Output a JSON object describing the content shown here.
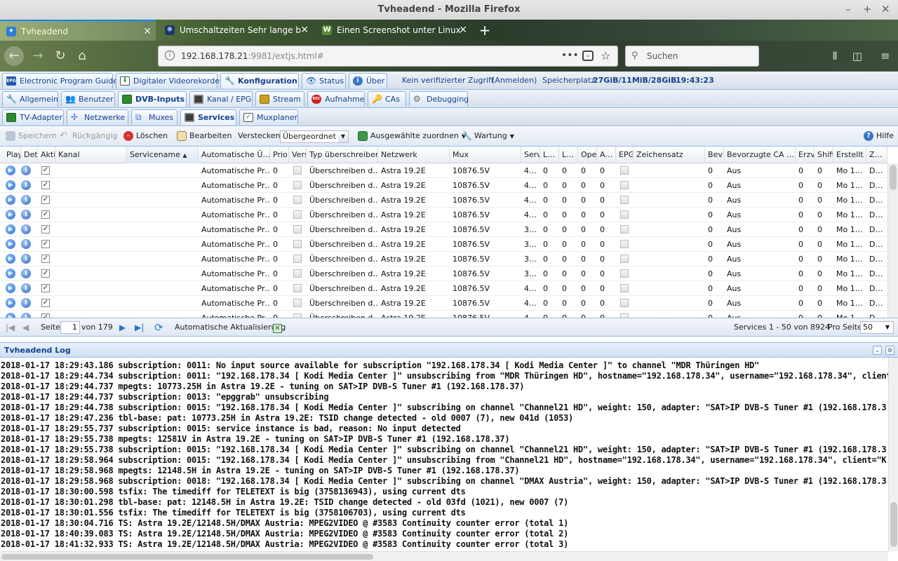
{
  "window": {
    "title": "Tvheadend - Mozilla Firefox"
  },
  "browser": {
    "tabs": [
      {
        "label": "Tvheadend",
        "active": true
      },
      {
        "label": "Umschaltzeiten Sehr lange b",
        "active": false
      },
      {
        "label": "Einen Screenshot unter Linux",
        "active": false
      }
    ],
    "url_host": "192.168.178.21",
    "url_rest": ":9981/extjs.html#",
    "search_placeholder": "Suchen"
  },
  "main_tabs": [
    "Electronic Program Guide",
    "Digitaler Videorekorder",
    "Konfiguration",
    "Status",
    "Über"
  ],
  "status_info": {
    "access": "Kein verifizierter Zugriff",
    "login": "(Anmelden)",
    "storage_label": "Speicherplatz:",
    "storage_value": "27GiB/11MiB/28GiB",
    "time": "19:43:23"
  },
  "config_tabs": [
    "Allgemein",
    "Benutzer",
    "DVB-Inputs",
    "Kanal / EPG",
    "Stream",
    "Aufnahme",
    "CAs",
    "Debugging"
  ],
  "dvb_tabs": [
    "TV-Adapter",
    "Netzwerke",
    "Muxes",
    "Services",
    "Muxplaner"
  ],
  "actions": {
    "save": "Speichern",
    "undo": "Rückgängig",
    "delete": "Löschen",
    "edit": "Bearbeiten",
    "hide_label": "Verstecken:",
    "hide_value": "Übergeordnet d",
    "map": "Ausgewählte zuordnen",
    "maintenance": "Wartung",
    "help": "Hilfe"
  },
  "grid": {
    "columns": [
      "Play",
      "Det",
      "Akti",
      "Kanal",
      "Servicename",
      "Automatische Ü…",
      "Prio",
      "Vers",
      "Typ überschreiben",
      "Netzwerk",
      "Mux",
      "Serv",
      "L…",
      "L…",
      "Ope",
      "A…",
      "EPG",
      "Zeichensatz",
      "Bev",
      "Bevorzugte CA …",
      "Erzv",
      "Shift",
      "Erstellt",
      "Z…"
    ],
    "rows": [
      {
        "kanal": "",
        "name": "",
        "auto": "Automatische Pr…",
        "prio": "0",
        "typ": "Überschreiben d…",
        "netz": "Astra 19.2E",
        "mux": "10876.5V",
        "serv": "4…",
        "l1": "0",
        "l2": "0",
        "ope": "0",
        "a": "0",
        "bev": "0",
        "ca": "Aus",
        "erzv": "0",
        "shift": "0",
        "erst": "Mo 1…",
        "z": "D…"
      },
      {
        "kanal": "",
        "name": "",
        "auto": "Automatische Pr…",
        "prio": "0",
        "typ": "Überschreiben d…",
        "netz": "Astra 19.2E",
        "mux": "10876.5V",
        "serv": "4…",
        "l1": "0",
        "l2": "0",
        "ope": "0",
        "a": "0",
        "bev": "0",
        "ca": "Aus",
        "erzv": "0",
        "shift": "0",
        "erst": "Mo 1…",
        "z": "D…"
      },
      {
        "kanal": "",
        "name": "",
        "auto": "Automatische Pr…",
        "prio": "0",
        "typ": "Überschreiben d…",
        "netz": "Astra 19.2E",
        "mux": "10876.5V",
        "serv": "4…",
        "l1": "0",
        "l2": "0",
        "ope": "0",
        "a": "0",
        "bev": "0",
        "ca": "Aus",
        "erzv": "0",
        "shift": "0",
        "erst": "Mo 1…",
        "z": "D…"
      },
      {
        "kanal": "",
        "name": "",
        "auto": "Automatische Pr…",
        "prio": "0",
        "typ": "Überschreiben d…",
        "netz": "Astra 19.2E",
        "mux": "10876.5V",
        "serv": "4…",
        "l1": "0",
        "l2": "0",
        "ope": "0",
        "a": "0",
        "bev": "0",
        "ca": "Aus",
        "erzv": "0",
        "shift": "0",
        "erst": "Mo 1…",
        "z": "D…"
      },
      {
        "kanal": "",
        "name": "",
        "auto": "Automatische Pr…",
        "prio": "0",
        "typ": "Überschreiben d…",
        "netz": "Astra 19.2E",
        "mux": "10876.5V",
        "serv": "3…",
        "l1": "0",
        "l2": "0",
        "ope": "0",
        "a": "0",
        "bev": "0",
        "ca": "Aus",
        "erzv": "0",
        "shift": "0",
        "erst": "Mo 1…",
        "z": "D…"
      },
      {
        "kanal": "",
        "name": "",
        "auto": "Automatische Pr…",
        "prio": "0",
        "typ": "Überschreiben d…",
        "netz": "Astra 19.2E",
        "mux": "10876.5V",
        "serv": "3…",
        "l1": "0",
        "l2": "0",
        "ope": "0",
        "a": "0",
        "bev": "0",
        "ca": "Aus",
        "erzv": "0",
        "shift": "0",
        "erst": "Mo 1…",
        "z": "D…"
      },
      {
        "kanal": "",
        "name": "",
        "auto": "Automatische Pr…",
        "prio": "0",
        "typ": "Überschreiben d…",
        "netz": "Astra 19.2E",
        "mux": "10876.5V",
        "serv": "3…",
        "l1": "0",
        "l2": "0",
        "ope": "0",
        "a": "0",
        "bev": "0",
        "ca": "Aus",
        "erzv": "0",
        "shift": "0",
        "erst": "Mo 1…",
        "z": "D…"
      },
      {
        "kanal": "",
        "name": "",
        "auto": "Automatische Pr…",
        "prio": "0",
        "typ": "Überschreiben d…",
        "netz": "Astra 19.2E",
        "mux": "10876.5V",
        "serv": "3…",
        "l1": "0",
        "l2": "0",
        "ope": "0",
        "a": "0",
        "bev": "0",
        "ca": "Aus",
        "erzv": "0",
        "shift": "0",
        "erst": "Mo 1…",
        "z": "D…"
      },
      {
        "kanal": "",
        "name": "",
        "auto": "Automatische Pr…",
        "prio": "0",
        "typ": "Überschreiben d…",
        "netz": "Astra 19.2E",
        "mux": "10876.5V",
        "serv": "4…",
        "l1": "0",
        "l2": "0",
        "ope": "0",
        "a": "0",
        "bev": "0",
        "ca": "Aus",
        "erzv": "0",
        "shift": "0",
        "erst": "Mo 1…",
        "z": "D…"
      },
      {
        "kanal": "",
        "name": "",
        "auto": "Automatische Pr…",
        "prio": "0",
        "typ": "Überschreiben d…",
        "netz": "Astra 19.2E",
        "mux": "10876.5V",
        "serv": "4…",
        "l1": "0",
        "l2": "0",
        "ope": "0",
        "a": "0",
        "bev": "0",
        "ca": "Aus",
        "erzv": "0",
        "shift": "0",
        "erst": "Mo 1…",
        "z": "D…"
      },
      {
        "kanal": "",
        "name": "",
        "auto": "Automatische Pr…",
        "prio": "0",
        "typ": "Überschreiben d…",
        "netz": "Astra 19.2E",
        "mux": "10876.5V",
        "serv": "4…",
        "l1": "0",
        "l2": "0",
        "ope": "0",
        "a": "0",
        "bev": "0",
        "ca": "Aus",
        "erzv": "0",
        "shift": "0",
        "erst": "Mo 1…",
        "z": "D…"
      }
    ]
  },
  "paging": {
    "page_label": "Seite",
    "page_value": "1",
    "of_label": "von 179",
    "auto_refresh": "Automatische Aktualisierung",
    "summary": "Services 1 - 50 von 8924",
    "per_page_label": "Pro Seite",
    "per_page_value": "50"
  },
  "log": {
    "title": "Tvheadend Log",
    "lines": [
      "2018-01-17 18:29:43.186 subscription: 0011: No input source available for subscription \"192.168.178.34 [ Kodi Media Center ]\" to channel \"MDR Thüringen HD\"",
      "2018-01-17 18:29:44.734 subscription: 0011: \"192.168.178.34 [ Kodi Media Center ]\" unsubscribing from \"MDR Thüringen HD\", hostname=\"192.168.178.34\", username=\"192.168.178.34\", client",
      "2018-01-17 18:29:44.737 mpegts: 10773.25H in Astra 19.2E - tuning on SAT>IP DVB-S Tuner #1 (192.168.178.37)",
      "2018-01-17 18:29:44.737 subscription: 0013: \"epggrab\" unsubscribing",
      "2018-01-17 18:29:44.738 subscription: 0015: \"192.168.178.34 [ Kodi Media Center ]\" subscribing on channel \"Channel21 HD\", weight: 150, adapter: \"SAT>IP DVB-S Tuner #1 (192.168.178.3",
      "2018-01-17 18:29:47.236 tbl-base: pat: 10773.25H in Astra 19.2E: TSID change detected - old 0007 (7), new 041d (1053)",
      "2018-01-17 18:29:55.737 subscription: 0015: service instance is bad, reason: No input detected",
      "2018-01-17 18:29:55.738 mpegts: 12581V in Astra 19.2E - tuning on SAT>IP DVB-S Tuner #1 (192.168.178.37)",
      "2018-01-17 18:29:55.738 subscription: 0015: \"192.168.178.34 [ Kodi Media Center ]\" subscribing on channel \"Channel21 HD\", weight: 150, adapter: \"SAT>IP DVB-S Tuner #1 (192.168.178.3",
      "2018-01-17 18:29:58.964 subscription: 0015: \"192.168.178.34 [ Kodi Media Center ]\" unsubscribing from \"Channel21 HD\", hostname=\"192.168.178.34\", username=\"192.168.178.34\", client=\"K",
      "2018-01-17 18:29:58.968 mpegts: 12148.5H in Astra 19.2E - tuning on SAT>IP DVB-S Tuner #1 (192.168.178.37)",
      "2018-01-17 18:29:58.968 subscription: 0018: \"192.168.178.34 [ Kodi Media Center ]\" subscribing on channel \"DMAX Austria\", weight: 150, adapter: \"SAT>IP DVB-S Tuner #1 (192.168.178.3",
      "2018-01-17 18:30:00.598 tsfix: The timediff for TELETEXT is big (3758136943), using current dts",
      "2018-01-17 18:30:01.298 tbl-base: pat: 12148.5H in Astra 19.2E: TSID change detected - old 03fd (1021), new 0007 (7)",
      "2018-01-17 18:30:01.556 tsfix: The timediff for TELETEXT is big (3758106703), using current dts",
      "2018-01-17 18:30:04.716 TS: Astra 19.2E/12148.5H/DMAX Austria: MPEG2VIDEO @ #3583 Continuity counter error (total 1)",
      "2018-01-17 18:40:39.083 TS: Astra 19.2E/12148.5H/DMAX Austria: MPEG2VIDEO @ #3583 Continuity counter error (total 2)",
      "2018-01-17 18:41:32.933 TS: Astra 19.2E/12148.5H/DMAX Austria: MPEG2VIDEO @ #3583 Continuity counter error (total 3)"
    ]
  }
}
